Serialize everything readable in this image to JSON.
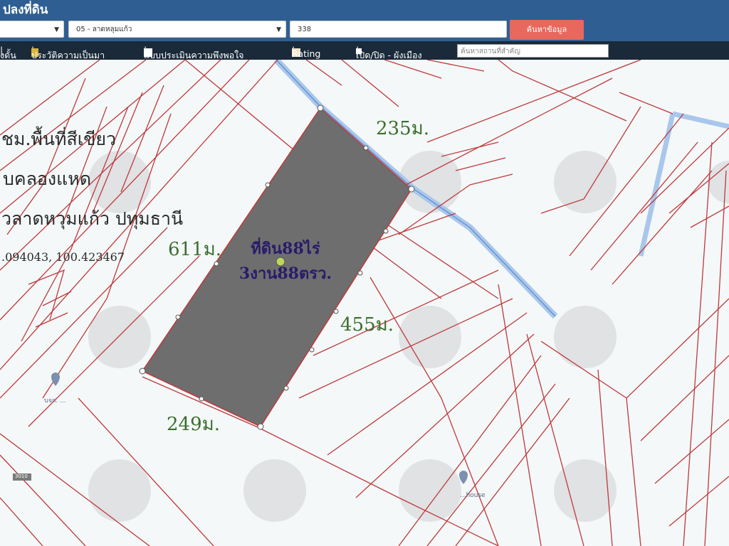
{
  "header": {
    "title": "ปลงที่ดิน",
    "district_select": "05 - ลาดหลุมแก้ว",
    "parcel_input": "338",
    "search_button": "ค้นหาข้อมูล"
  },
  "menu": {
    "item1": "งดั้น",
    "item2": "ประวัติความเป็นมา",
    "item3": "แบบประเมินความพึงพอใจ",
    "item4": "Rating",
    "item5": "เปิด/ปิด - ผังเมือง",
    "search_placeholder": "ค้นหาสถานที่สำคัญ"
  },
  "annotations": {
    "line1": "ชม.พื้นที่สีเขียว",
    "line2": "บคลองแหด",
    "line3": "วลาดหวุมแก้ว ปทุมธานี",
    "line4": ".094043, 100.423467",
    "plot_name_line1": "ที่ดิน88ไร่",
    "plot_name_line2": "3งาน88ตรว.",
    "measure_top": "235ม.",
    "measure_left": "611ม.",
    "measure_right": "455ม.",
    "measure_bottom": "249ม."
  },
  "pois": {
    "poi1": "บจก. ...",
    "poi2": "...house",
    "road_tag": "3010"
  },
  "colors": {
    "header_bg": "#2f5f92",
    "menu_bg": "#1a2a3a",
    "button": "#e8685d",
    "parcel_lines": "#c0383c",
    "plot_fill": "#6e6e6e",
    "canal": "#a9c7ec"
  }
}
